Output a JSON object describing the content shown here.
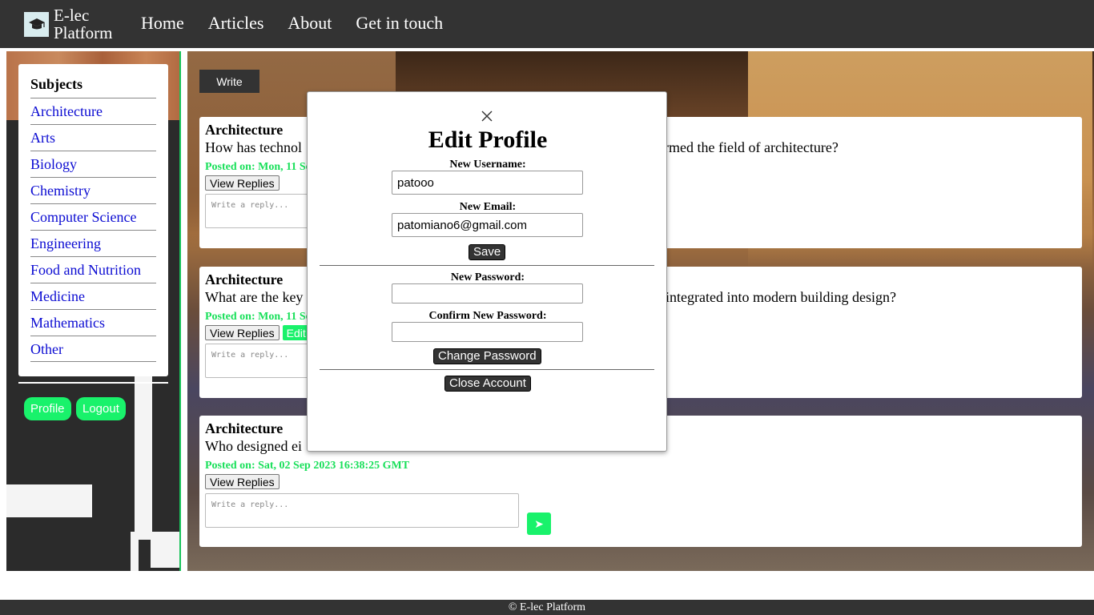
{
  "brand": {
    "name_line1": "E-lec",
    "name_line2": "Platform",
    "logo_icon": "graduation-cap-icon"
  },
  "nav": {
    "items": [
      "Home",
      "Articles",
      "About",
      "Get in touch"
    ]
  },
  "sidebar": {
    "title": "Subjects",
    "subjects": [
      "Architecture",
      "Arts",
      "Biology",
      "Chemistry",
      "Computer Science",
      "Engineering",
      "Food and Nutrition",
      "Medicine",
      "Mathematics",
      "Other"
    ],
    "profile_label": "Profile",
    "logout_label": "Logout"
  },
  "main": {
    "write_label": "Write",
    "posts": [
      {
        "subject": "Architecture",
        "question_start": "How has technol",
        "question_end": "rmed the field of architecture?",
        "date": "Posted on: Mon, 11 Se",
        "view_replies": "View Replies",
        "reply_placeholder": "Write a reply..."
      },
      {
        "subject": "Architecture",
        "question_start": "What are the key",
        "question_end": "integrated into modern building design?",
        "date": "Posted on: Mon, 11 Se",
        "view_replies": "View Replies",
        "edit_label": "Edit",
        "reply_placeholder": "Write a reply..."
      },
      {
        "subject": "Architecture",
        "question_start": "Who designed ei",
        "date": "Posted on: Sat, 02 Sep 2023 16:38:25 GMT",
        "view_replies": "View Replies",
        "reply_placeholder": "Write a reply...",
        "send_icon": "send-arrow-icon"
      }
    ]
  },
  "modal": {
    "title": "Edit Profile",
    "close_icon": "close-icon",
    "username_label": "New Username:",
    "username_value": "patooo",
    "email_label": "New Email:",
    "email_value": "patomiano6@gmail.com",
    "save_label": "Save",
    "password_label": "New Password:",
    "confirm_label": "Confirm New Password:",
    "change_password_label": "Change Password",
    "close_account_label": "Close Account"
  },
  "footer": {
    "text": "© E-lec Platform"
  },
  "colors": {
    "accent_green": "#19f26b",
    "dark_bar": "#333333",
    "link_blue": "#0b0bd2"
  }
}
